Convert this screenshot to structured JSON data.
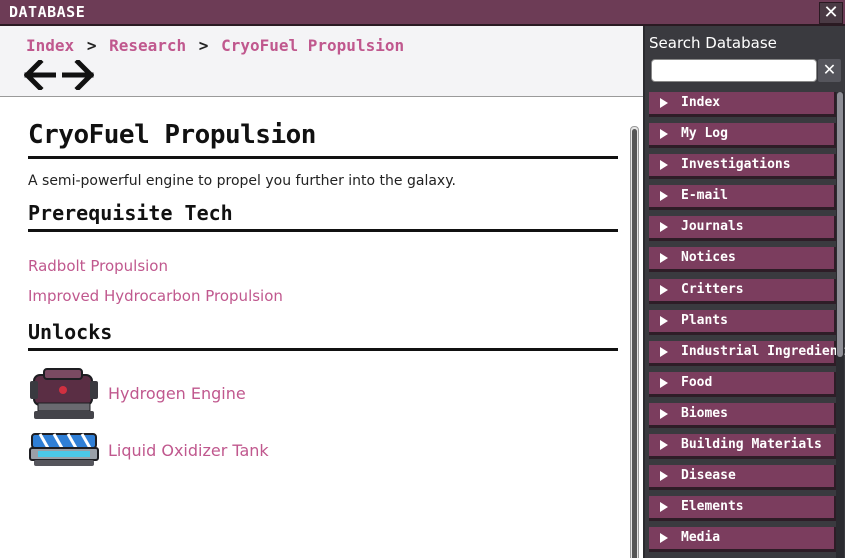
{
  "window": {
    "title": "DATABASE",
    "close_glyph": "✕"
  },
  "breadcrumb": {
    "items": [
      "Index",
      "Research",
      "CryoFuel Propulsion"
    ],
    "separator": ">"
  },
  "article": {
    "title": "CryoFuel Propulsion",
    "description": "A semi-powerful engine to propel you further into the galaxy.",
    "prereq_heading": "Prerequisite Tech",
    "prerequisites": [
      "Radbolt Propulsion",
      "Improved Hydrocarbon Propulsion"
    ],
    "unlocks_heading": "Unlocks",
    "unlocks": [
      {
        "label": "Hydrogen Engine",
        "icon": "hydrogen-engine-icon"
      },
      {
        "label": "Liquid Oxidizer Tank",
        "icon": "liquid-oxidizer-tank-icon"
      }
    ]
  },
  "sidebar": {
    "search_label": "Search Database",
    "search_value": "",
    "clear_glyph": "✕",
    "categories": [
      "Index",
      "My Log",
      "Investigations",
      "E-mail",
      "Journals",
      "Notices",
      "Critters",
      "Plants",
      "Industrial Ingredients",
      "Food",
      "Biomes",
      "Building Materials",
      "Disease",
      "Elements",
      "Media"
    ]
  },
  "colors": {
    "titlebar": "#6d3c56",
    "link": "#c0588e",
    "category_bg": "#7b3d5e",
    "sidebar_bg": "#3a3a3f"
  }
}
